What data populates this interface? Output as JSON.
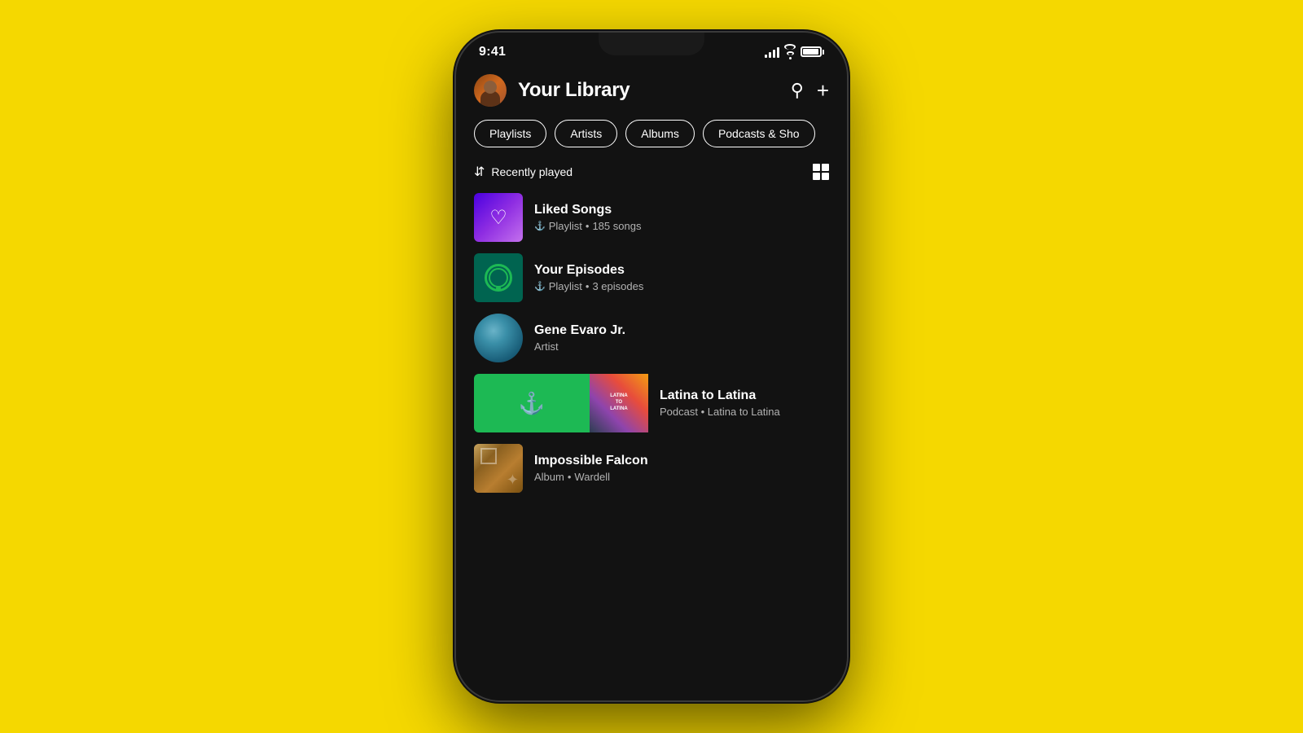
{
  "background_color": "#F5D800",
  "phone": {
    "status_bar": {
      "time": "9:41"
    },
    "header": {
      "title": "Your Library",
      "search_label": "Search",
      "add_label": "Add"
    },
    "filters": {
      "chips": [
        {
          "id": "playlists",
          "label": "Playlists"
        },
        {
          "id": "artists",
          "label": "Artists"
        },
        {
          "id": "albums",
          "label": "Albums"
        },
        {
          "id": "podcasts",
          "label": "Podcasts & Sho"
        }
      ]
    },
    "sort": {
      "label": "Recently played",
      "grid_label": "Grid view"
    },
    "library_items": [
      {
        "id": "liked-songs",
        "name": "Liked Songs",
        "sub_type": "Playlist",
        "sub_detail": "185 songs",
        "pinned": true,
        "thumb_type": "liked"
      },
      {
        "id": "your-episodes",
        "name": "Your Episodes",
        "sub_type": "Playlist",
        "sub_detail": "3 episodes",
        "pinned": true,
        "thumb_type": "episodes"
      },
      {
        "id": "gene-evaro",
        "name": "Gene Evaro Jr.",
        "sub_type": "Artist",
        "sub_detail": "",
        "pinned": false,
        "thumb_type": "artist"
      }
    ],
    "dual_item": {
      "podcast_name": "Latina to Latina",
      "podcast_sub_type": "Podcast",
      "podcast_sub_detail": "Latina to Latina"
    },
    "bottom_item": {
      "name": "Impossible Falcon",
      "sub_type": "Album",
      "sub_detail": "Wardell"
    }
  }
}
